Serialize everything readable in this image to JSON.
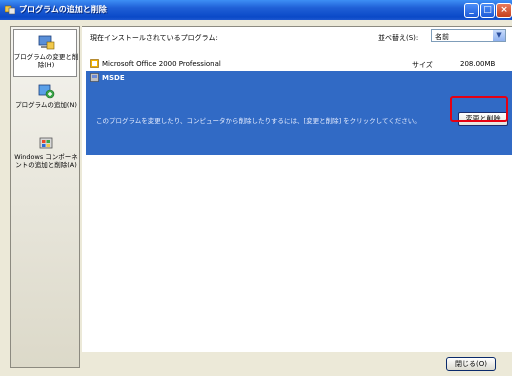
{
  "window": {
    "title": "プログラムの追加と削除"
  },
  "sidebar": {
    "items": [
      {
        "label": "プログラムの変更と削除(H)",
        "icon": "program-change-icon"
      },
      {
        "label": "プログラムの追加(N)",
        "icon": "program-add-icon"
      },
      {
        "label": "Windows コンポーネントの追加と削除(A)",
        "icon": "windows-components-icon"
      }
    ]
  },
  "main": {
    "header_title": "現在インストールされているプログラム:",
    "sort_label": "並べ替え(S):",
    "sort_value": "名前",
    "programs": [
      {
        "name": "Microsoft Office 2000 Professional",
        "size_label": "サイズ",
        "size_value": "208.00MB"
      },
      {
        "name": "MSDE",
        "message": "このプログラムを変更したり、コンピュータから削除したりするには、[変更と削除] をクリックしてください。",
        "button": "変更と削除"
      }
    ]
  },
  "footer": {
    "close_label": "閉じる(O)"
  },
  "colors": {
    "selection": "#316ac5",
    "highlight": "#e60012",
    "titlebar": "#0a49c8"
  }
}
